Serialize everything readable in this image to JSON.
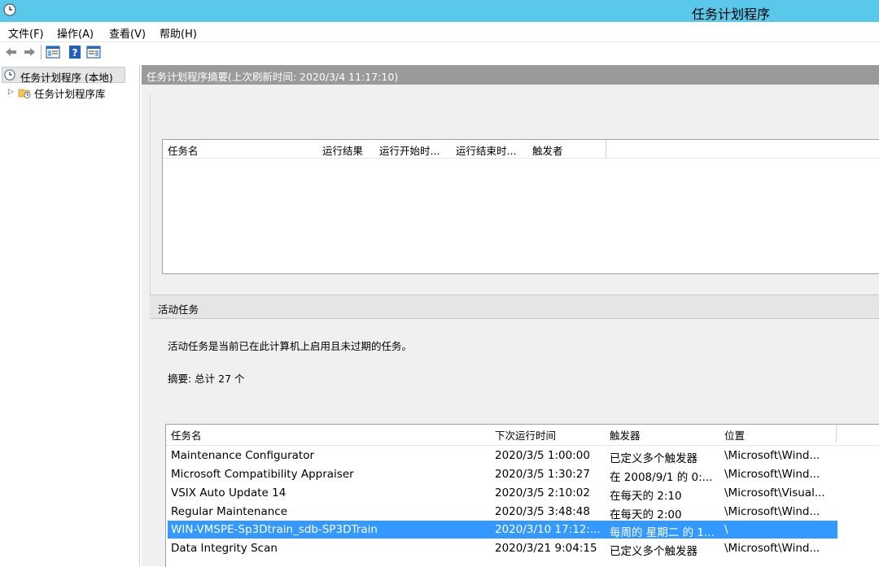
{
  "window": {
    "title": "任务计划程序"
  },
  "menu": [
    {
      "label": "文件(F)"
    },
    {
      "label": "操作(A)"
    },
    {
      "label": "查看(V)"
    },
    {
      "label": "帮助(H)"
    }
  ],
  "tree": {
    "root_label": "任务计划程序 (本地)",
    "child_label": "任务计划程序库"
  },
  "main": {
    "header": "任务计划程序摘要(上次刷新时间: 2020/3/4 11:17:10)",
    "status_columns": [
      "任务名",
      "运行结果",
      "运行开始时...",
      "运行结束时...",
      "触发者"
    ],
    "active_section_title": "活动任务",
    "active_description": "活动任务是当前已在此计算机上启用且未过期的任务。",
    "active_summary": "摘要: 总计 27 个",
    "active_columns": [
      "任务名",
      "下次运行时间",
      "触发器",
      "位置"
    ],
    "active_rows": [
      {
        "name": "Maintenance Configurator",
        "next_run": "2020/3/5 1:00:00",
        "trigger": "已定义多个触发器",
        "location": "\\Microsoft\\Wind...",
        "selected": false
      },
      {
        "name": "Microsoft Compatibility Appraiser",
        "next_run": "2020/3/5 1:30:27",
        "trigger": "在 2008/9/1 的 0:...",
        "location": "\\Microsoft\\Wind...",
        "selected": false
      },
      {
        "name": "VSIX Auto Update 14",
        "next_run": "2020/3/5 2:10:02",
        "trigger": "在每天的 2:10",
        "location": "\\Microsoft\\Visual...",
        "selected": false
      },
      {
        "name": "Regular Maintenance",
        "next_run": "2020/3/5 3:48:48",
        "trigger": "在每天的 2:00",
        "location": "\\Microsoft\\Wind...",
        "selected": false
      },
      {
        "name": "WIN-VMSPE-Sp3Dtrain_sdb-SP3DTrain",
        "next_run": "2020/3/10 17:12:...",
        "trigger": "每周的 星期二 的 1...",
        "location": "\\",
        "selected": true
      },
      {
        "name": "Data Integrity Scan",
        "next_run": "2020/3/21 9:04:15",
        "trigger": "已定义多个触发器",
        "location": "\\Microsoft\\Wind...",
        "selected": false
      }
    ]
  },
  "colors": {
    "titlebar": "#59c8ea",
    "selection": "#3399ff",
    "header_gray": "#9a9a9a"
  },
  "icons": [
    "clock-icon",
    "back-arrow-icon",
    "forward-arrow-icon",
    "show-hide-console-tree-icon",
    "help-icon",
    "show-action-pane-icon",
    "folder-clock-icon"
  ]
}
